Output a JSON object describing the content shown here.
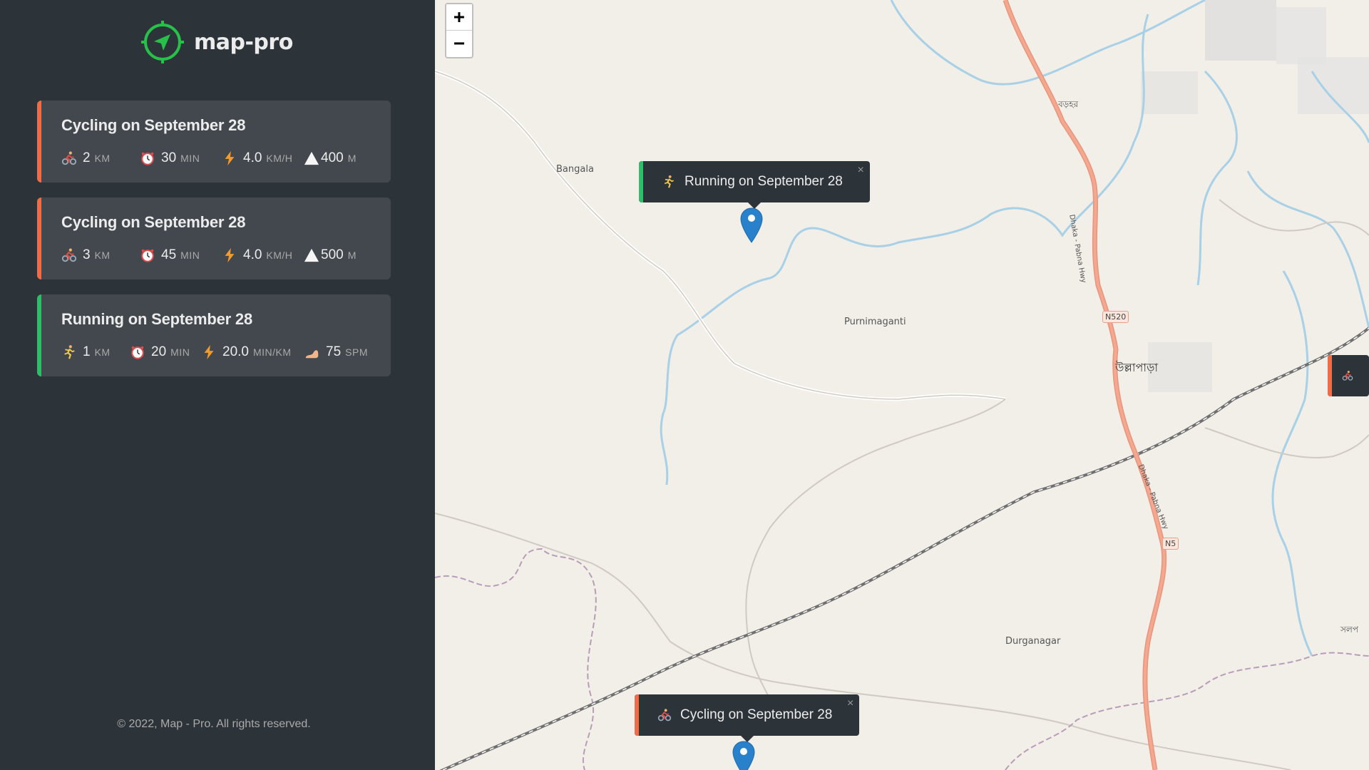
{
  "app": {
    "name": "map-pro",
    "accent": "#27c14a",
    "copyright": "© 2022, Map - Pro. All rights reserved."
  },
  "colors": {
    "cycling": "#ef6c47",
    "running": "#2fbd6a"
  },
  "workouts": [
    {
      "type": "cycling",
      "title": "Cycling on September 28",
      "details": [
        {
          "icon": "cyclist-icon",
          "value": "2",
          "unit": "km"
        },
        {
          "icon": "stopwatch-icon",
          "value": "30",
          "unit": "min"
        },
        {
          "icon": "lightning-icon",
          "value": "4.0",
          "unit": "km/h"
        },
        {
          "icon": "mountain-icon",
          "value": "400",
          "unit": "m"
        }
      ]
    },
    {
      "type": "cycling",
      "title": "Cycling on September 28",
      "details": [
        {
          "icon": "cyclist-icon",
          "value": "3",
          "unit": "km"
        },
        {
          "icon": "stopwatch-icon",
          "value": "45",
          "unit": "min"
        },
        {
          "icon": "lightning-icon",
          "value": "4.0",
          "unit": "km/h"
        },
        {
          "icon": "mountain-icon",
          "value": "500",
          "unit": "m"
        }
      ]
    },
    {
      "type": "running",
      "title": "Running on September 28",
      "details": [
        {
          "icon": "runner-icon",
          "value": "1",
          "unit": "km"
        },
        {
          "icon": "stopwatch-icon",
          "value": "20",
          "unit": "min"
        },
        {
          "icon": "lightning-icon",
          "value": "20.0",
          "unit": "min/km"
        },
        {
          "icon": "footprint-icon",
          "value": "75",
          "unit": "spm"
        }
      ]
    }
  ],
  "map": {
    "zoom_in": "+",
    "zoom_out": "−",
    "popup_close": "×",
    "popups": [
      {
        "type": "running",
        "icon": "runner-icon",
        "text": "Running on September 28"
      },
      {
        "type": "cycling",
        "icon": "cyclist-icon",
        "text": "Cycling on September 28"
      }
    ],
    "labels": {
      "bangala": "Bangala",
      "purnimaganti": "Purnimaganti",
      "durganagar": "Durganagar",
      "ullapara": "উল্লাপাড়া",
      "borohor": "বড়হর",
      "solop": "সলপ",
      "n520": "N520",
      "n5": "N5",
      "hwy1": "Dhaka - Pabna Hwy",
      "hwy2": "Dhaka - Pabna Hwy"
    }
  }
}
